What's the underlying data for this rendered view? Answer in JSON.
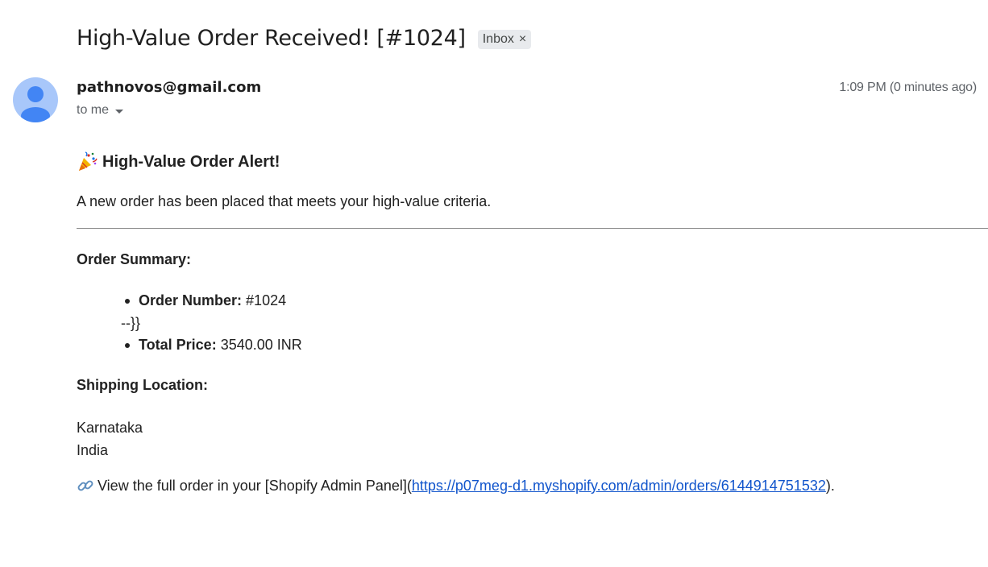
{
  "email": {
    "subject": "High-Value Order Received! [#1024]",
    "label": "Inbox",
    "label_remove": "×",
    "sender": "pathnovos@gmail.com",
    "recipient": "to me",
    "timestamp": "1:09 PM (0 minutes ago)"
  },
  "message": {
    "heading_emoji": "party-popper-icon",
    "heading": "High-Value Order Alert!",
    "intro": "A new order has been placed that meets your high-value criteria.",
    "summary_title": "Order Summary:",
    "summary_items": [
      {
        "label": "Order Number:",
        "value": "#1024"
      },
      {
        "label": "Total Price:",
        "value": "3540.00 INR"
      }
    ],
    "stray_text": "--}}",
    "shipping_title": "Shipping Location:",
    "shipping_lines": [
      "Karnataka",
      "India"
    ],
    "view_prefix": "View the full order in your [Shopify Admin Panel](",
    "view_link": "https://p07meg-d1.myshopify.com/admin/orders/6144914751532",
    "view_suffix": ").",
    "view_icon": "link-icon"
  },
  "colors": {
    "avatar_bg": "#a8c7fa",
    "avatar_fg": "#4285f4",
    "link": "#1155cc",
    "chip_bg": "#e8eaed"
  }
}
